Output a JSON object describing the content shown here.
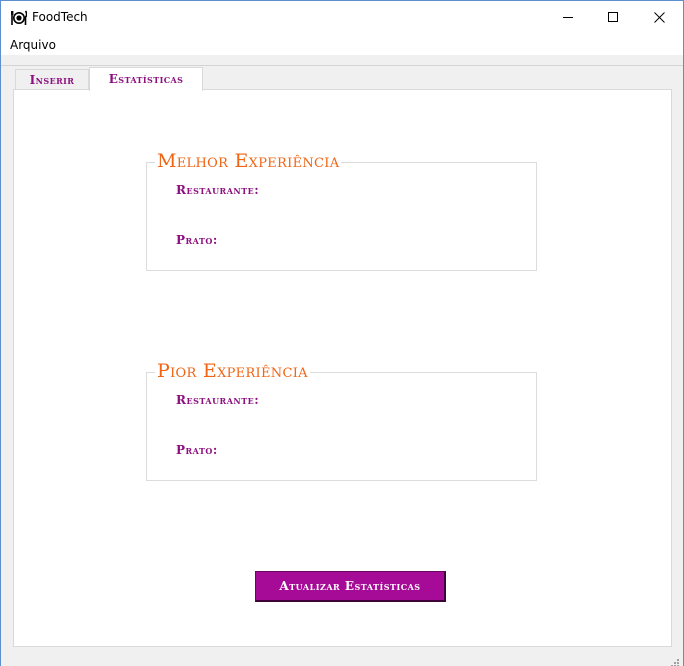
{
  "window": {
    "title": "FoodTech",
    "icon": "plate-cutlery-icon"
  },
  "menu": {
    "items": [
      {
        "label": "Arquivo"
      }
    ]
  },
  "tabs": [
    {
      "label": "Inserir",
      "active": false
    },
    {
      "label": "Estatísticas",
      "active": true
    }
  ],
  "stats": {
    "best": {
      "title": "Melhor Experiência",
      "restaurant_label": "Restaurante:",
      "dish_label": "Prato:"
    },
    "worst": {
      "title": "Pior Experiência",
      "restaurant_label": "Restaurante:",
      "dish_label": "Prato:"
    },
    "update_button": "Atualizar Estatísticas"
  },
  "colors": {
    "accent_purple": "#8b0f7e",
    "button_purple": "#a60b98",
    "title_orange": "#f06414"
  }
}
